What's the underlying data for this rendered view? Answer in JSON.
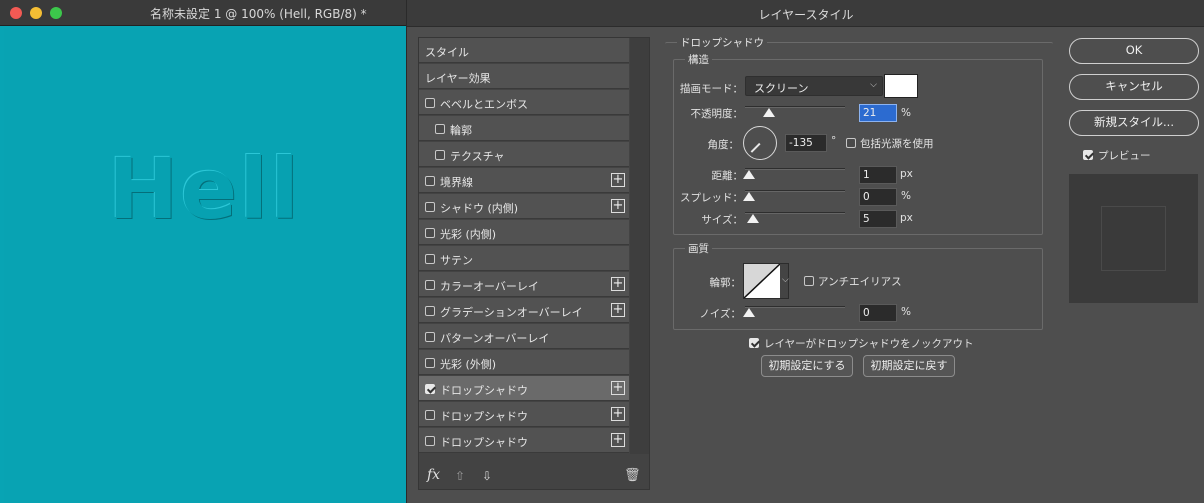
{
  "document": {
    "title": "名称未設定 1 @ 100% (Hell, RGB/8) *",
    "canvas_text": "Hell"
  },
  "dialog": {
    "title": "レイヤースタイル",
    "list": [
      {
        "label": "スタイル",
        "checkbox": null,
        "plus": false
      },
      {
        "label": "レイヤー効果",
        "checkbox": null,
        "plus": false
      },
      {
        "label": "ベベルとエンボス",
        "checkbox": false,
        "plus": false
      },
      {
        "label": "輪郭",
        "checkbox": false,
        "plus": false,
        "indent": true
      },
      {
        "label": "テクスチャ",
        "checkbox": false,
        "plus": false,
        "indent": true
      },
      {
        "label": "境界線",
        "checkbox": false,
        "plus": true
      },
      {
        "label": "シャドウ (内側)",
        "checkbox": false,
        "plus": true
      },
      {
        "label": "光彩 (内側)",
        "checkbox": false,
        "plus": false
      },
      {
        "label": "サテン",
        "checkbox": false,
        "plus": false
      },
      {
        "label": "カラーオーバーレイ",
        "checkbox": false,
        "plus": true
      },
      {
        "label": "グラデーションオーバーレイ",
        "checkbox": false,
        "plus": true
      },
      {
        "label": "パターンオーバーレイ",
        "checkbox": false,
        "plus": false
      },
      {
        "label": "光彩 (外側)",
        "checkbox": false,
        "plus": false
      },
      {
        "label": "ドロップシャドウ",
        "checkbox": true,
        "plus": true,
        "selected": true
      },
      {
        "label": "ドロップシャドウ",
        "checkbox": false,
        "plus": true
      },
      {
        "label": "ドロップシャドウ",
        "checkbox": false,
        "plus": true
      }
    ],
    "footer": {
      "fx": "fx",
      "up": "⇧",
      "down": "⇩",
      "trash": "🗑"
    },
    "panel": {
      "title": "ドロップシャドウ",
      "structure": {
        "title": "構造",
        "blend_mode_label": "描画モード：",
        "blend_mode_value": "スクリーン",
        "blend_color": "#ffffff",
        "opacity_label": "不透明度：",
        "opacity_value": "21",
        "opacity_level": 21,
        "angle_label": "角度：",
        "angle_value": "-135",
        "angle_unit": "°",
        "global_light_label": "包括光源を使用",
        "global_light_checked": false,
        "distance_label": "距離：",
        "distance_value": "1",
        "spread_label": "スプレッド：",
        "spread_value": "0",
        "size_label": "サイズ：",
        "size_value": "5",
        "unit_px": "px",
        "unit_pct": "%"
      },
      "quality": {
        "title": "画質",
        "contour_label": "輪郭：",
        "antialias_label": "アンチエイリアス",
        "antialias_checked": false,
        "noise_label": "ノイズ：",
        "noise_value": "0",
        "unit_pct": "%"
      },
      "knockout_label": "レイヤーがドロップシャドウをノックアウト",
      "knockout_checked": true,
      "make_default": "初期設定にする",
      "reset_default": "初期設定に戻す"
    },
    "buttons": {
      "ok": "OK",
      "cancel": "キャンセル",
      "new_style": "新規スタイル..."
    },
    "preview_label": "プレビュー",
    "preview_checked": true
  },
  "colors": {
    "canvas": "#08a4b4",
    "dialog_bg": "#4e4e4e",
    "selection_highlight": "#2c6bd0"
  }
}
